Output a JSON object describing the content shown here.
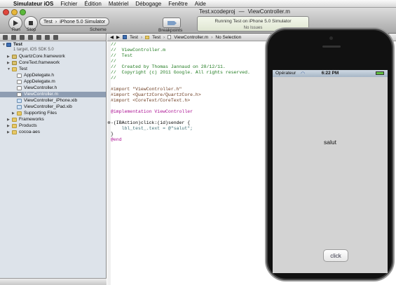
{
  "menubar": {
    "apple": "",
    "app": "Simulateur iOS",
    "items": [
      "Fichier",
      "Édition",
      "Matériel",
      "Débogage",
      "Fenêtre",
      "Aide"
    ]
  },
  "window": {
    "title_file": "Test.xcodeproj",
    "title_sep": "—",
    "title_doc": "ViewController.m"
  },
  "toolbar": {
    "run_label": "Run",
    "stop_label": "Stop",
    "scheme_target": "Test",
    "scheme_sep": "›",
    "scheme_device": "iPhone 5.0 Simulator",
    "scheme_label": "Scheme",
    "breakpoints_label": "Breakpoints",
    "activity_status": "Running Test on iPhone 5.0 Simulator",
    "activity_issues": "No Issues"
  },
  "navigator": {
    "project_name": "Test",
    "project_subtitle": "1 target, iOS SDK 5.0",
    "items": [
      "QuartzCore.framework",
      "CoreText.framework",
      "Test",
      "AppDelegate.h",
      "AppDelegate.m",
      "ViewController.h",
      "ViewController.m",
      "ViewController_iPhone.xib",
      "ViewController_iPad.xib",
      "Supporting Files",
      "Frameworks",
      "Products",
      "cocoa-aes"
    ]
  },
  "jumpbar": {
    "crumbs": [
      "Test",
      "Test",
      "ViewController.m",
      "No Selection"
    ]
  },
  "code": {
    "lines": [
      "//",
      "//  ViewController.m",
      "//  Test",
      "//",
      "//  Created by Thomas Jannaud on 28/12/11.",
      "//  Copyright (c) 2011 Google. All rights reserved.",
      "//",
      "",
      "#import \"ViewController.h\"",
      "#import <QuartzCore/QuartzCore.h>",
      "#import <CoreText/CoreText.h>",
      "",
      "@implementation ViewController",
      "",
      "-(IBAction)click:(id)sender {",
      "    lbl_test_.text = @\"salut\";",
      "}",
      "@end"
    ]
  },
  "simulator": {
    "carrier": "Opérateur",
    "time": "6:22 PM",
    "label_text": "salut",
    "button_text": "click"
  }
}
